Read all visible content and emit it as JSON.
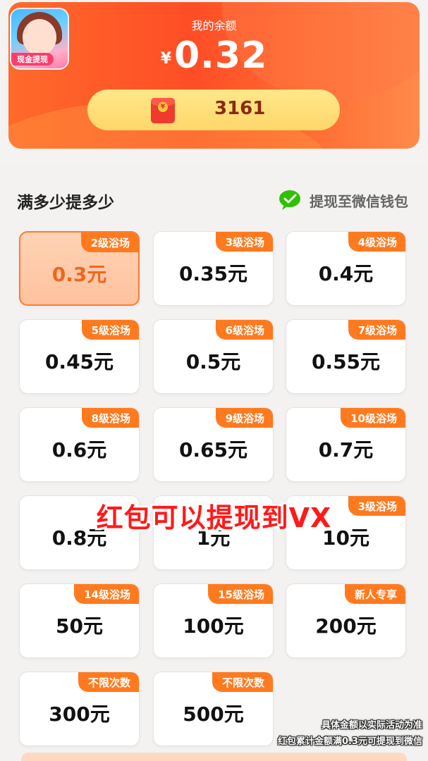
{
  "header": {
    "app_icon_badge": "现金提现",
    "balance_label": "我的余额",
    "currency": "¥",
    "balance": "0.32",
    "coins": "3161"
  },
  "section": {
    "title": "满多少提多少",
    "wechat_label": "提现至微信钱包"
  },
  "options": [
    {
      "tag": "2级浴场",
      "amount": "0.3元"
    },
    {
      "tag": "3级浴场",
      "amount": "0.35元"
    },
    {
      "tag": "4级浴场",
      "amount": "0.4元"
    },
    {
      "tag": "5级浴场",
      "amount": "0.45元"
    },
    {
      "tag": "6级浴场",
      "amount": "0.5元"
    },
    {
      "tag": "7级浴场",
      "amount": "0.55元"
    },
    {
      "tag": "8级浴场",
      "amount": "0.6元"
    },
    {
      "tag": "9级浴场",
      "amount": "0.65元"
    },
    {
      "tag": "10级浴场",
      "amount": "0.7元"
    },
    {
      "tag": "",
      "amount": "0.8元"
    },
    {
      "tag": "",
      "amount": "1元"
    },
    {
      "tag": "3级浴场",
      "amount": "10元"
    },
    {
      "tag": "14级浴场",
      "amount": "50元"
    },
    {
      "tag": "15级浴场",
      "amount": "100元"
    },
    {
      "tag": "新人专享",
      "amount": "200元"
    },
    {
      "tag": "不限次数",
      "amount": "300元"
    },
    {
      "tag": "不限次数",
      "amount": "500元"
    }
  ],
  "overlay": {
    "caption": "红包可以提现到VX",
    "note_line1": "具体金额以实际活动为准",
    "note_line2": "红包累计金额满0.3元可提现到微信"
  },
  "colors": {
    "accent": "#ff7a1e",
    "header": "#ff4d26",
    "wechat_green": "#2dc100",
    "caption_red": "#ff1a1a"
  }
}
